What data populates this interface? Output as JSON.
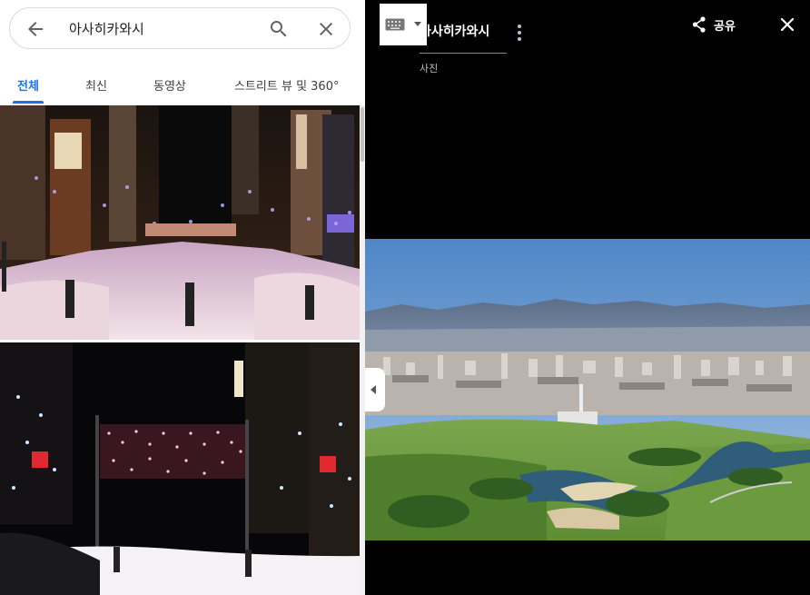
{
  "search": {
    "query": "아사히카와시",
    "back_icon": "arrow-left-icon",
    "search_icon": "search-icon",
    "clear_icon": "close-icon"
  },
  "tabs": [
    {
      "label": "전체",
      "active": true
    },
    {
      "label": "최신",
      "active": false
    },
    {
      "label": "동영상",
      "active": false
    },
    {
      "label": "스트리트 뷰 및 360°",
      "active": false
    }
  ],
  "viewer": {
    "title": "아사히카와시",
    "subtitle": "사진",
    "share_label": "공유",
    "share_icon": "share-icon",
    "close_icon": "close-icon",
    "more_icon": "more-vert-icon",
    "keyboard_icon": "keyboard-icon"
  },
  "colors": {
    "accent": "#1a73e8",
    "viewer_bg": "#000000"
  }
}
